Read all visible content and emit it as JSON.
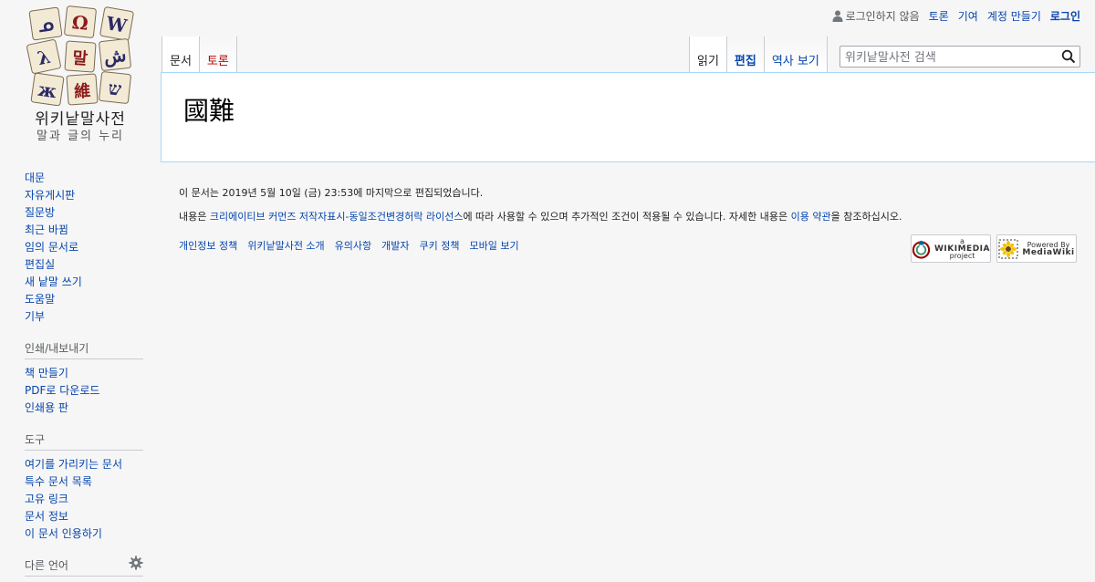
{
  "personal": {
    "not_logged_in": "로그인하지 않음",
    "talk": "토론",
    "contributions": "기여",
    "create_account": "계정 만들기",
    "login": "로그인"
  },
  "logo": {
    "brand": "위키낱말사전",
    "tagline": "말과 글의 누리",
    "tiles": [
      "ᓄ",
      "Ω",
      "W",
      "λ",
      "말",
      "ش",
      "ж",
      "維",
      "ש"
    ]
  },
  "tabs": {
    "left": [
      "문서",
      "토론"
    ],
    "right": [
      "읽기",
      "편집",
      "역사 보기"
    ]
  },
  "search": {
    "placeholder": "위키낱말사전 검색"
  },
  "page": {
    "title": "國難"
  },
  "sidebar": {
    "navigation": [
      "대문",
      "자유게시판",
      "질문방",
      "최근 바뀜",
      "임의 문서로",
      "편집실",
      "새 낱말 쓰기",
      "도움말",
      "기부"
    ],
    "print": {
      "heading": "인쇄/내보내기",
      "items": [
        "책 만들기",
        "PDF로 다운로드",
        "인쇄용 판"
      ]
    },
    "tools": {
      "heading": "도구",
      "items": [
        "여기를 가리키는 문서",
        "특수 문서 목록",
        "고유 링크",
        "문서 정보",
        "이 문서 인용하기"
      ]
    },
    "languages": {
      "heading": "다른 언어"
    }
  },
  "footer": {
    "last_modified": "이 문서는 2019년 5월 10일 (금) 23:53에 마지막으로 편집되었습니다.",
    "license_prefix": "내용은 ",
    "license_link": "크리에이티브 커먼즈 저작자표시-동일조건변경허락 라이선스",
    "license_middle": "에 따라 사용할 수 있으며 추가적인 조건이 적용될 수 있습니다. 자세한 내용은 ",
    "terms_link": "이용 약관",
    "license_suffix": "을 참조하십시오.",
    "places": [
      "개인정보 정책",
      "위키낱말사전 소개",
      "유의사항",
      "개발자",
      "쿠키 정책",
      "모바일 보기"
    ],
    "wikimedia_badge": {
      "line1": "a",
      "line2": "WIKIMEDIA",
      "line3": "project"
    },
    "mediawiki_badge": {
      "line1": "Powered By",
      "line2": "MediaWiki"
    }
  },
  "colors": {
    "link": "#0645ad",
    "new_link": "#ba0000",
    "content_border": "#a7d7f9",
    "background": "#f6f6f6"
  }
}
